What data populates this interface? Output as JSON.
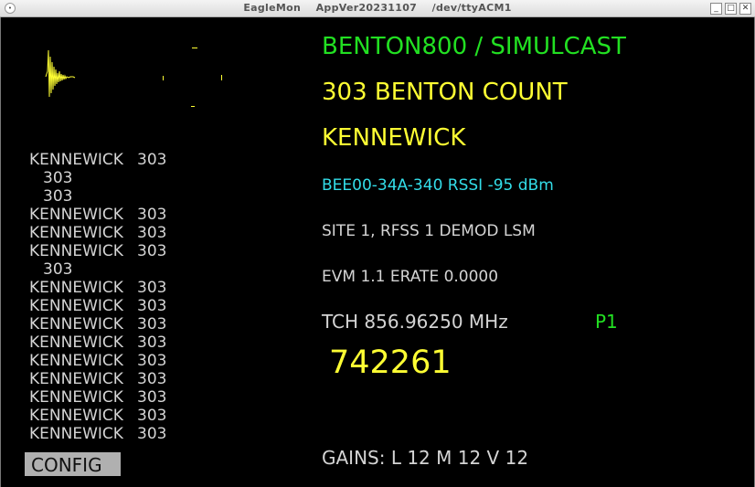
{
  "window": {
    "title": "EagleMon    AppVer20231107    /dev/ttyACM1",
    "menu_glyph": "•",
    "minimize_glyph": "_",
    "maximize_glyph": "□",
    "close_glyph": "✕"
  },
  "status": {
    "system": "BENTON800 / SIMULCAST",
    "talkgroup": "303  BENTON COUNT",
    "site_name": "KENNEWICK",
    "id_rssi": "BEE00-34A-340  RSSI -95 dBm",
    "site_info": "SITE 1, RFSS 1 DEMOD LSM",
    "evm": "EVM 1.1  ERATE 0.0000",
    "tch": "TCH 856.96250 MHz",
    "phase": "P1",
    "radio_id": "742261",
    "gains": "GAINS: L 12 M 12 V 12"
  },
  "log": [
    {
      "city": "KENNEWICK",
      "tg": "303"
    },
    {
      "city": "",
      "tg": "303"
    },
    {
      "city": "",
      "tg": "303"
    },
    {
      "city": "KENNEWICK",
      "tg": "303"
    },
    {
      "city": "KENNEWICK",
      "tg": "303"
    },
    {
      "city": "KENNEWICK",
      "tg": "303"
    },
    {
      "city": "",
      "tg": "303"
    },
    {
      "city": "KENNEWICK",
      "tg": "303"
    },
    {
      "city": "KENNEWICK",
      "tg": "303"
    },
    {
      "city": "KENNEWICK",
      "tg": "303"
    },
    {
      "city": "KENNEWICK",
      "tg": "303"
    },
    {
      "city": "KENNEWICK",
      "tg": "303"
    },
    {
      "city": "KENNEWICK",
      "tg": "303"
    },
    {
      "city": "KENNEWICK",
      "tg": "303"
    },
    {
      "city": "KENNEWICK",
      "tg": "303"
    },
    {
      "city": "KENNEWICK",
      "tg": "303"
    }
  ],
  "buttons": {
    "config": "CONFIG"
  },
  "colors": {
    "system": "#22e022",
    "talkgroup": "#ffff33",
    "info": "#33dde8",
    "text": "#d4d4d4",
    "scope": "#ffff33"
  }
}
